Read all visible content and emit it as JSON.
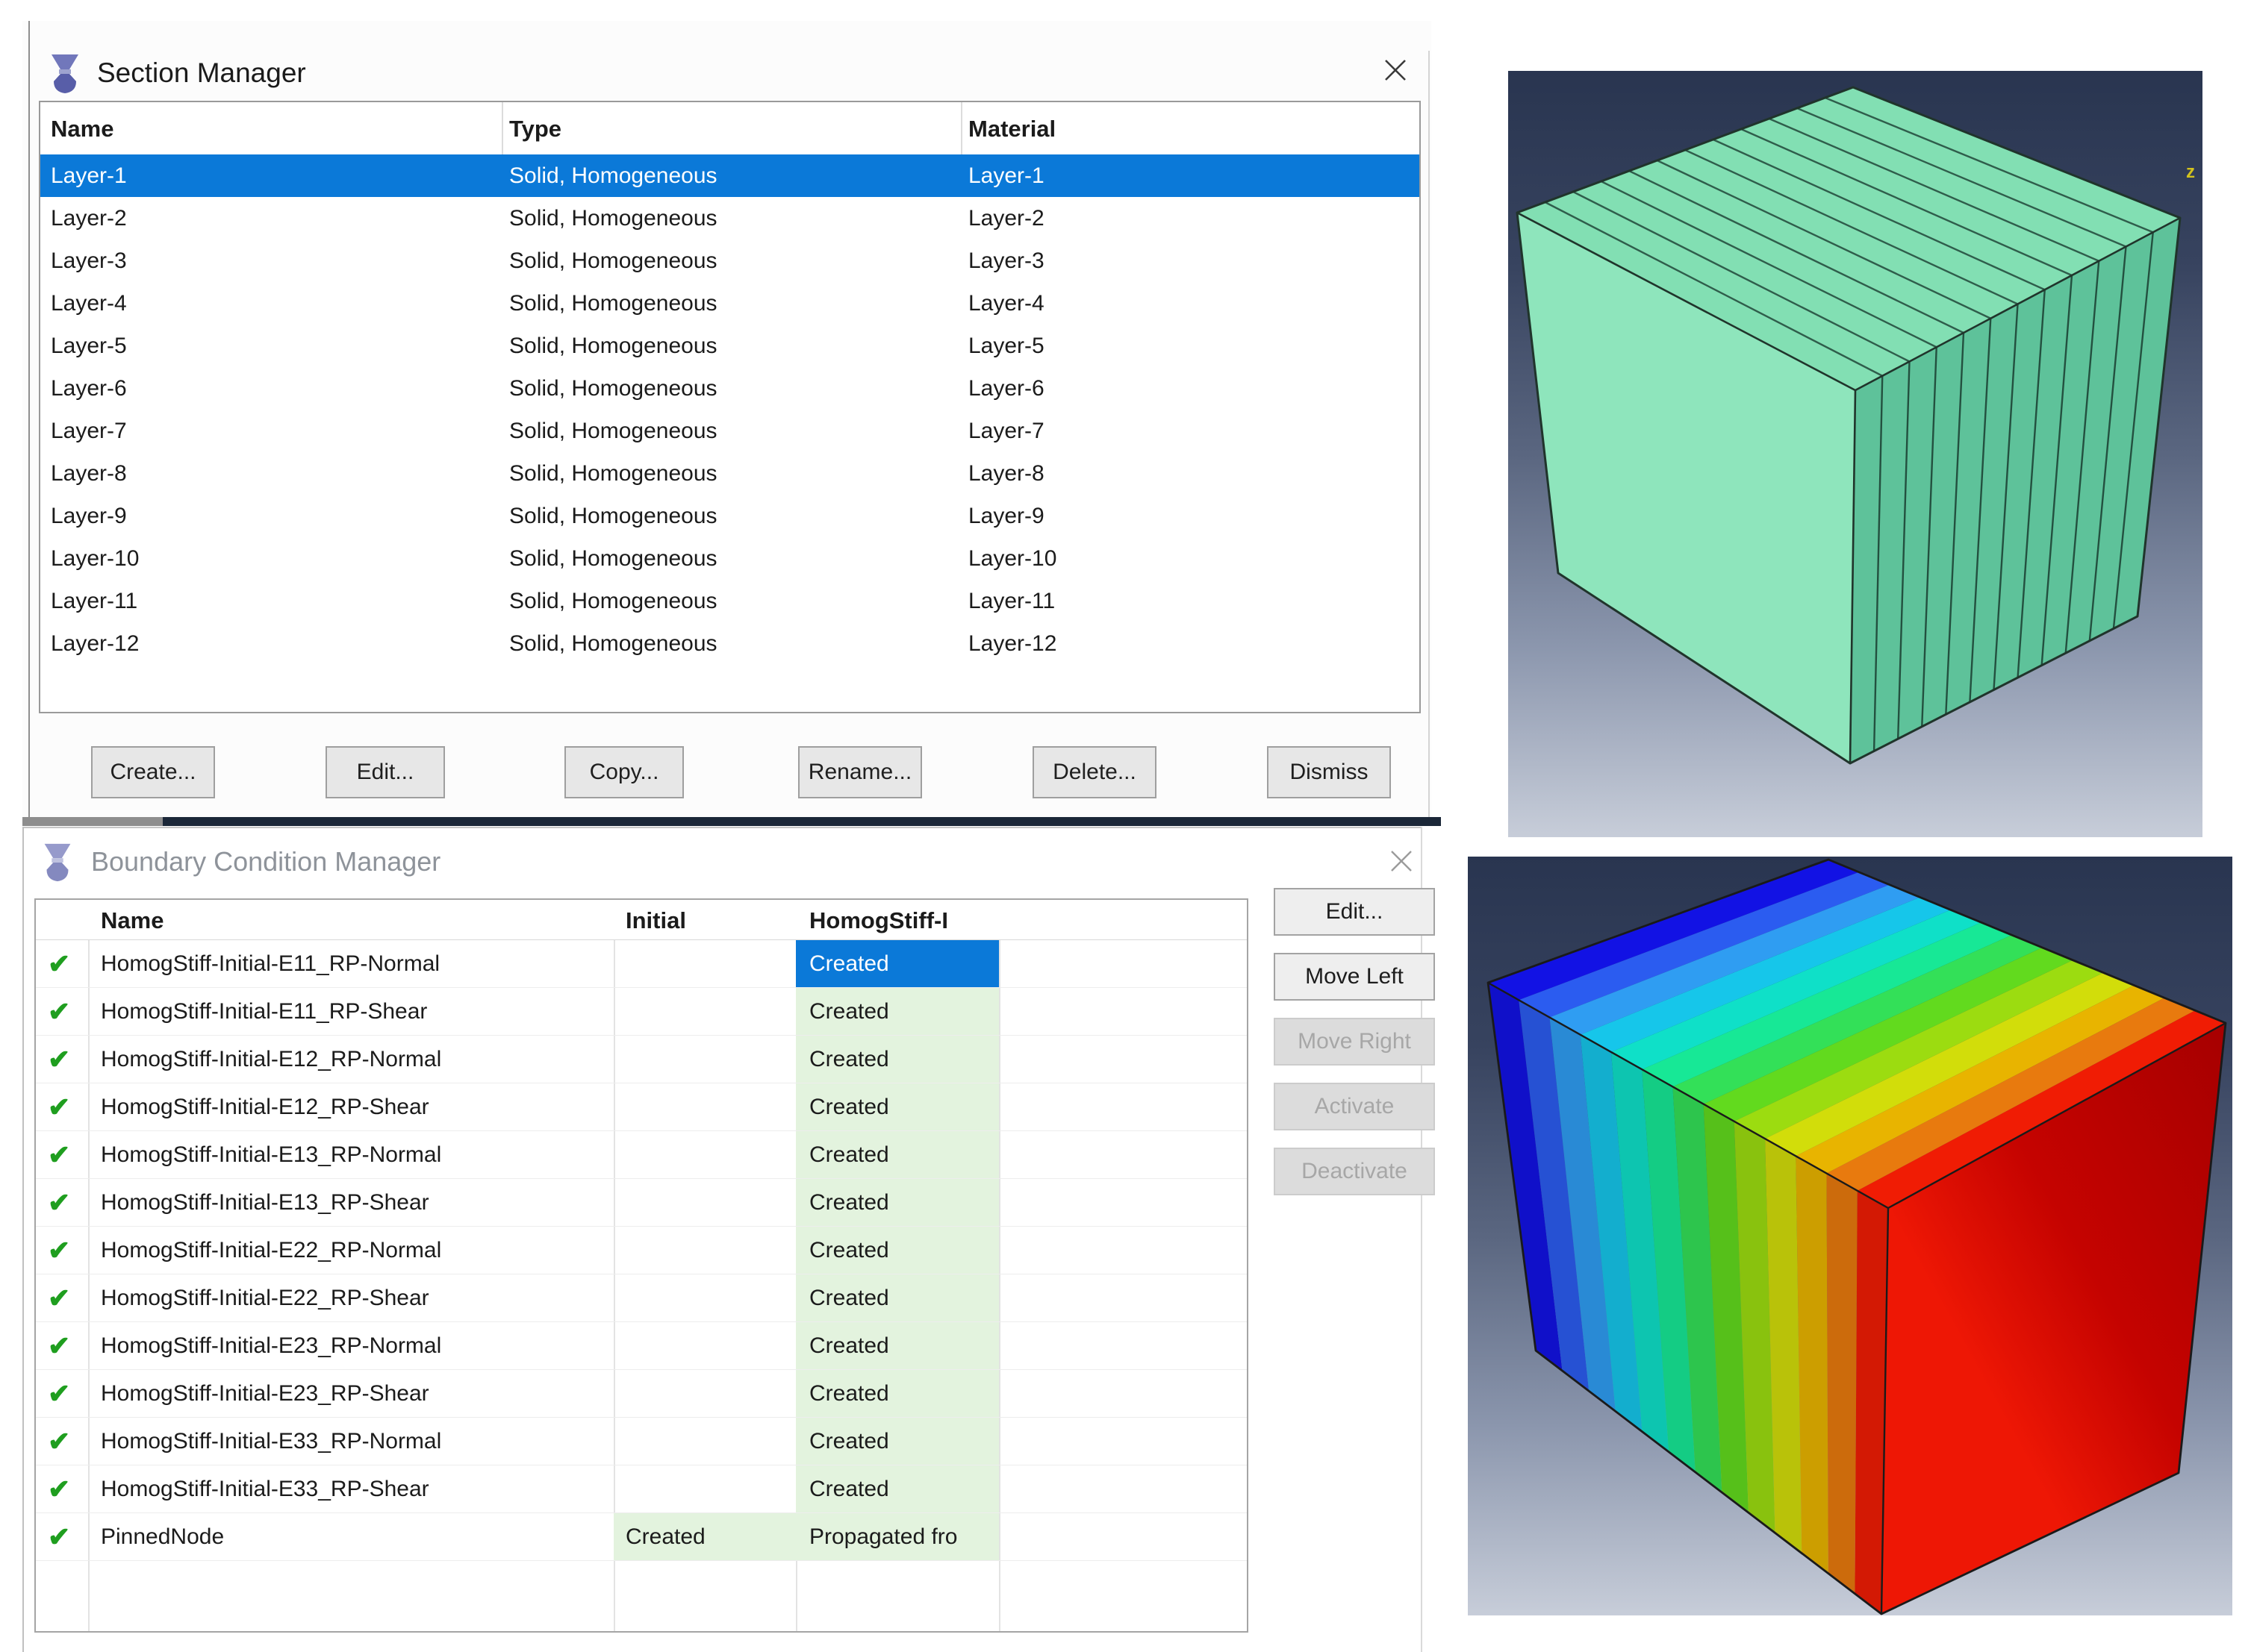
{
  "section_manager": {
    "title": "Section Manager",
    "icon": "abaqus-spool-icon",
    "close_icon": "x",
    "columns": [
      "Name",
      "Type",
      "Material"
    ],
    "selected_row": 0,
    "rows": [
      {
        "name": "Layer-1",
        "type": "Solid, Homogeneous",
        "material": "Layer-1"
      },
      {
        "name": "Layer-2",
        "type": "Solid, Homogeneous",
        "material": "Layer-2"
      },
      {
        "name": "Layer-3",
        "type": "Solid, Homogeneous",
        "material": "Layer-3"
      },
      {
        "name": "Layer-4",
        "type": "Solid, Homogeneous",
        "material": "Layer-4"
      },
      {
        "name": "Layer-5",
        "type": "Solid, Homogeneous",
        "material": "Layer-5"
      },
      {
        "name": "Layer-6",
        "type": "Solid, Homogeneous",
        "material": "Layer-6"
      },
      {
        "name": "Layer-7",
        "type": "Solid, Homogeneous",
        "material": "Layer-7"
      },
      {
        "name": "Layer-8",
        "type": "Solid, Homogeneous",
        "material": "Layer-8"
      },
      {
        "name": "Layer-9",
        "type": "Solid, Homogeneous",
        "material": "Layer-9"
      },
      {
        "name": "Layer-10",
        "type": "Solid, Homogeneous",
        "material": "Layer-10"
      },
      {
        "name": "Layer-11",
        "type": "Solid, Homogeneous",
        "material": "Layer-11"
      },
      {
        "name": "Layer-12",
        "type": "Solid, Homogeneous",
        "material": "Layer-12"
      }
    ],
    "buttons": [
      "Create...",
      "Edit...",
      "Copy...",
      "Rename...",
      "Delete...",
      "Dismiss"
    ]
  },
  "bc_manager": {
    "title": "Boundary Condition Manager",
    "icon": "abaqus-spool-icon",
    "close_icon": "x",
    "columns": [
      "Name",
      "Initial",
      "HomogStiff-I"
    ],
    "rows": [
      {
        "name": "HomogStiff-Initial-E11_RP-Normal",
        "initial": "",
        "step": "Created",
        "selected": true
      },
      {
        "name": "HomogStiff-Initial-E11_RP-Shear",
        "initial": "",
        "step": "Created",
        "selected": false
      },
      {
        "name": "HomogStiff-Initial-E12_RP-Normal",
        "initial": "",
        "step": "Created",
        "selected": false
      },
      {
        "name": "HomogStiff-Initial-E12_RP-Shear",
        "initial": "",
        "step": "Created",
        "selected": false
      },
      {
        "name": "HomogStiff-Initial-E13_RP-Normal",
        "initial": "",
        "step": "Created",
        "selected": false
      },
      {
        "name": "HomogStiff-Initial-E13_RP-Shear",
        "initial": "",
        "step": "Created",
        "selected": false
      },
      {
        "name": "HomogStiff-Initial-E22_RP-Normal",
        "initial": "",
        "step": "Created",
        "selected": false
      },
      {
        "name": "HomogStiff-Initial-E22_RP-Shear",
        "initial": "",
        "step": "Created",
        "selected": false
      },
      {
        "name": "HomogStiff-Initial-E23_RP-Normal",
        "initial": "",
        "step": "Created",
        "selected": false
      },
      {
        "name": "HomogStiff-Initial-E23_RP-Shear",
        "initial": "",
        "step": "Created",
        "selected": false
      },
      {
        "name": "HomogStiff-Initial-E33_RP-Normal",
        "initial": "",
        "step": "Created",
        "selected": false
      },
      {
        "name": "HomogStiff-Initial-E33_RP-Shear",
        "initial": "",
        "step": "Created",
        "selected": false
      },
      {
        "name": "PinnedNode",
        "initial": "Created",
        "step": "Propagated fro",
        "selected": false
      }
    ],
    "check_glyph": "✔",
    "buttons": [
      {
        "label": "Edit...",
        "enabled": true
      },
      {
        "label": "Move Left",
        "enabled": true
      },
      {
        "label": "Move Right",
        "enabled": false
      },
      {
        "label": "Activate",
        "enabled": false
      },
      {
        "label": "Deactivate",
        "enabled": false
      }
    ]
  },
  "viewport_top": {
    "description": "layered-cube-render",
    "axis_label": "z",
    "axis_label_color": "#d3c21d",
    "layers": 12,
    "face_left": "#8ee5bc",
    "face_top": "#82dfb3",
    "face_right": "#5ec29a",
    "line_top": "#2f5d4b",
    "line_right": "#23503f",
    "edge": "#20342b"
  },
  "viewport_bottom": {
    "description": "rainbow-contour-cube-render",
    "bands": [
      "#1212e4",
      "#2b5cf0",
      "#2f9df2",
      "#16c6ea",
      "#0fe0c8",
      "#17e896",
      "#33e058",
      "#62da1e",
      "#9cdc10",
      "#d2dd0a",
      "#e8b400",
      "#e87a0e",
      "#f01c04"
    ],
    "right_face_stops": [
      "#ee1705",
      "#c50300",
      "#a60000"
    ],
    "edge": "#1a1a1a"
  },
  "colors": {
    "selection_blue": "#0b79d8",
    "created_cell_green": "#e3f3de",
    "check_green": "#1f9e1f",
    "window_strip_dark": "#1b2738",
    "window_strip_gray": "#8e8e8e",
    "inactive_title_gray": "#8e939a"
  }
}
